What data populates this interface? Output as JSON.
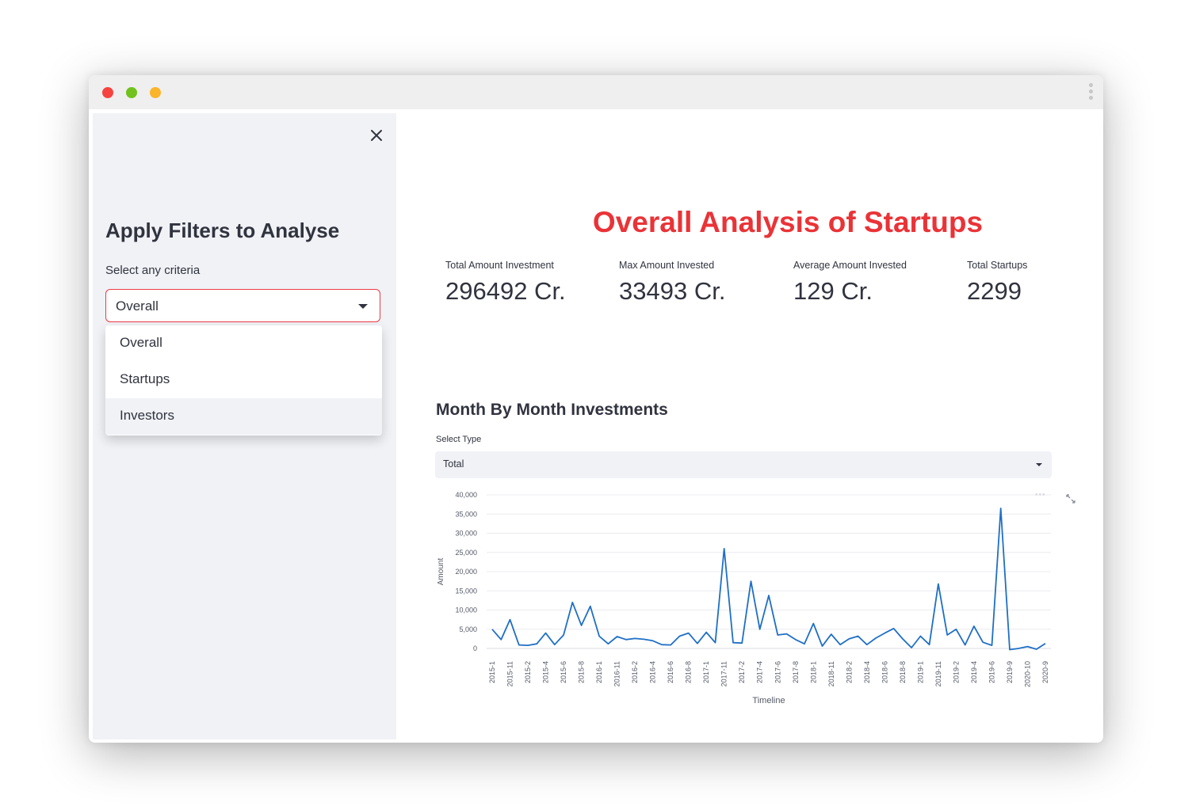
{
  "window_controls": {
    "close_color": "#f7433f",
    "minimize_color": "#71c21d",
    "maximize_color": "#fbb52a"
  },
  "sidebar": {
    "close_icon": "close-icon",
    "title": "Apply Filters to Analyse",
    "criteria_label": "Select any criteria",
    "criteria_value": "Overall",
    "options": [
      "Overall",
      "Startups",
      "Investors"
    ],
    "highlighted_option": "Investors"
  },
  "main": {
    "title": "Overall Analysis of Startups",
    "metrics": [
      {
        "label": "Total Amount Investment",
        "value": "296492 Cr."
      },
      {
        "label": "Max Amount Invested",
        "value": "33493 Cr."
      },
      {
        "label": "Average Amount Invested",
        "value": "129 Cr."
      },
      {
        "label": "Total Startups",
        "value": "2299"
      }
    ],
    "section_title": "Month By Month Investments",
    "type_label": "Select Type",
    "type_value": "Total"
  },
  "colors": {
    "accent": "#ea3337",
    "line": "#1f6fc5",
    "sidebar_bg": "#f0f2f6"
  },
  "chart_data": {
    "type": "line",
    "xlabel": "Timeline",
    "ylabel": "Amount",
    "ylim": [
      0,
      40000
    ],
    "yticks": [
      0,
      5000,
      10000,
      15000,
      20000,
      25000,
      30000,
      35000,
      40000
    ],
    "ytick_labels": [
      "0",
      "5,000",
      "10,000",
      "15,000",
      "20,000",
      "25,000",
      "30,000",
      "35,000",
      "40,000"
    ],
    "xtick_labels": [
      "2015-1",
      "2015-11",
      "2015-2",
      "2015-4",
      "2015-6",
      "2015-8",
      "2016-1",
      "2016-11",
      "2016-2",
      "2016-4",
      "2016-6",
      "2016-8",
      "2017-1",
      "2017-11",
      "2017-2",
      "2017-4",
      "2017-6",
      "2017-8",
      "2018-1",
      "2018-11",
      "2018-2",
      "2018-4",
      "2018-6",
      "2018-8",
      "2019-1",
      "2019-11",
      "2019-2",
      "2019-4",
      "2019-6",
      "2019-9",
      "2020-10",
      "2020-9"
    ],
    "grid": true,
    "series": [
      {
        "values": [
          5000,
          2300,
          7500,
          900,
          800,
          1200,
          4000,
          1000,
          3500,
          12000,
          6000,
          11000,
          3200,
          1200,
          3100,
          2300,
          2600,
          2400,
          2000,
          1000,
          900,
          3200,
          4000,
          1300,
          4200,
          1500,
          26000,
          1500,
          1400,
          17500,
          5000,
          13800,
          3500,
          3800,
          2300,
          1200,
          6500,
          600,
          3700,
          1000,
          2500,
          3200,
          1000,
          2700,
          4000,
          5200,
          2500,
          200,
          3200,
          1000,
          16800,
          3500,
          5000,
          900,
          5800,
          1600,
          800,
          36500,
          -300,
          0,
          500,
          -200,
          1300
        ]
      }
    ]
  }
}
